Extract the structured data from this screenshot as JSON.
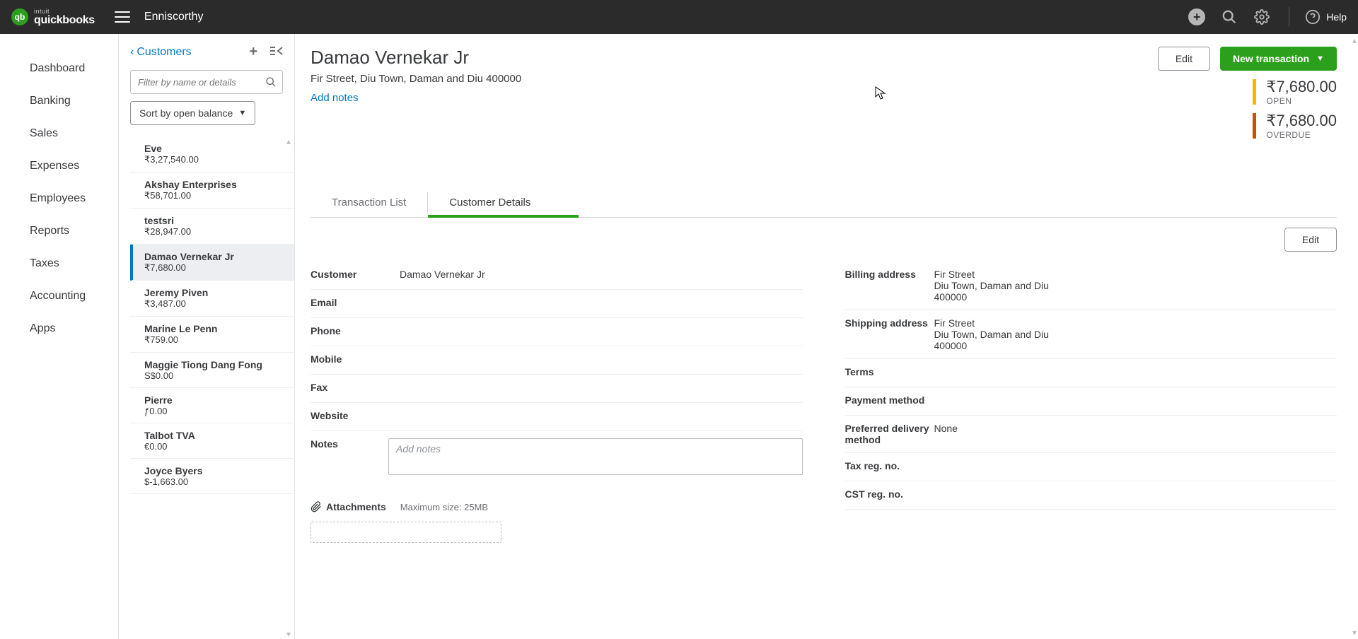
{
  "topbar": {
    "logo_small": "intuit",
    "logo_main": "quickbooks",
    "company": "Enniscorthy",
    "help_label": "Help"
  },
  "nav": {
    "items": [
      {
        "label": "Dashboard"
      },
      {
        "label": "Banking"
      },
      {
        "label": "Sales"
      },
      {
        "label": "Expenses"
      },
      {
        "label": "Employees"
      },
      {
        "label": "Reports"
      },
      {
        "label": "Taxes"
      },
      {
        "label": "Accounting"
      },
      {
        "label": "Apps"
      }
    ]
  },
  "list_panel": {
    "back_label": "Customers",
    "filter_placeholder": "Filter by name or details",
    "sort_label": "Sort by open balance",
    "customers": [
      {
        "name": "Eve",
        "balance": "₹3,27,540.00"
      },
      {
        "name": "Akshay Enterprises",
        "balance": "₹58,701.00"
      },
      {
        "name": "testsri",
        "balance": "₹28,947.00"
      },
      {
        "name": "Damao Vernekar Jr",
        "balance": "₹7,680.00"
      },
      {
        "name": "Jeremy Piven",
        "balance": "₹3,487.00"
      },
      {
        "name": "Marine Le Penn",
        "balance": "₹759.00"
      },
      {
        "name": "Maggie Tiong Dang Fong",
        "balance": "S$0.00"
      },
      {
        "name": "Pierre",
        "balance": "ƒ0.00"
      },
      {
        "name": "Talbot TVA",
        "balance": "€0.00"
      },
      {
        "name": "Joyce Byers",
        "balance": "$-1,663.00"
      }
    ]
  },
  "main": {
    "title": "Damao Vernekar Jr",
    "address_line": "Fir Street, Diu Town, Daman and Diu 400000",
    "add_notes": "Add notes",
    "edit_btn": "Edit",
    "new_txn_btn": "New transaction",
    "open_amount": "₹7,680.00",
    "open_label": "OPEN",
    "overdue_amount": "₹7,680.00",
    "overdue_label": "OVERDUE"
  },
  "tabs": {
    "list": "Transaction List",
    "details": "Customer Details"
  },
  "details": {
    "edit_btn": "Edit",
    "labels": {
      "customer": "Customer",
      "email": "Email",
      "phone": "Phone",
      "mobile": "Mobile",
      "fax": "Fax",
      "website": "Website",
      "notes": "Notes",
      "billing": "Billing address",
      "shipping": "Shipping address",
      "terms": "Terms",
      "payment_method": "Payment method",
      "pref_delivery": "Preferred delivery method",
      "tax_reg": "Tax reg. no.",
      "cst_reg": "CST reg. no."
    },
    "values": {
      "customer": "Damao Vernekar Jr",
      "billing_l1": "Fir Street",
      "billing_l2": "Diu Town, Daman and Diu",
      "billing_l3": "400000",
      "shipping_l1": "Fir Street",
      "shipping_l2": "Diu Town, Daman and Diu",
      "shipping_l3": "400000",
      "pref_delivery": "None"
    },
    "notes_placeholder": "Add notes",
    "attach_label": "Attachments",
    "attach_max": "Maximum size: 25MB"
  }
}
